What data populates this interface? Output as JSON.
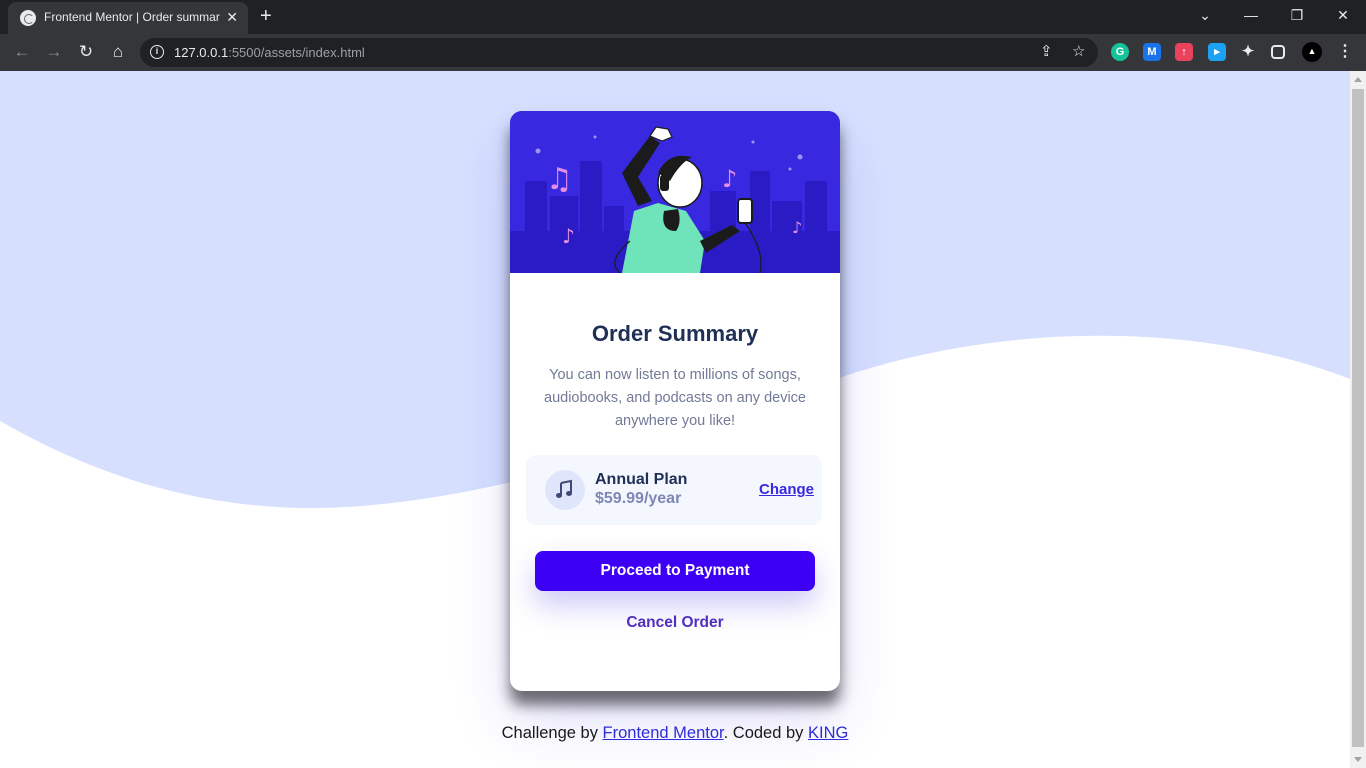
{
  "browser": {
    "tab_title": "Frontend Mentor | Order summary",
    "tab_close": "✕",
    "new_tab": "+",
    "url_host": "127.0.0.1",
    "url_path": ":5500/assets/index.html",
    "extensions": [
      "grammarly-icon",
      "m-extension-icon",
      "red-extension-icon",
      "blue-extension-icon",
      "puzzle-icon",
      "sidepanel-icon",
      "profile-avatar"
    ]
  },
  "card": {
    "title": "Order Summary",
    "description": "You can now listen to millions of songs, audiobooks, and podcasts on any device anywhere you like!",
    "plan": {
      "name": "Annual Plan",
      "price": "$59.99/year",
      "change_label": "Change"
    },
    "proceed_label": "Proceed to Payment",
    "cancel_label": "Cancel Order"
  },
  "attribution": {
    "prefix": "Challenge by ",
    "mentor_link": "Frontend Mentor",
    "middle": ". Coded by ",
    "author_link": "KING"
  },
  "colors": {
    "background_wave": "#d6e0fe",
    "hero": "#3829e0",
    "primary_button": "#3d00f5",
    "title": "#1f2f56"
  }
}
